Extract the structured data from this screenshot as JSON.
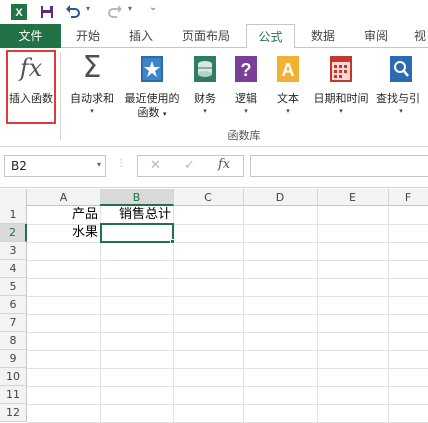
{
  "quick_access": {
    "save_icon": "save-icon",
    "undo_icon": "undo-icon",
    "redo_icon": "redo-icon",
    "customize_icon": "customize-qat-icon"
  },
  "tabs": [
    {
      "label": "文件"
    },
    {
      "label": "开始"
    },
    {
      "label": "插入"
    },
    {
      "label": "页面布局"
    },
    {
      "label": "公式"
    },
    {
      "label": "数据"
    },
    {
      "label": "审阅"
    },
    {
      "label": "视"
    }
  ],
  "ribbon": {
    "insert_function": {
      "label": "插入函数",
      "icon": "fx"
    },
    "autosum": {
      "label": "自动求和",
      "icon": "Σ"
    },
    "recently_used": {
      "label": "最近使用的",
      "label2": "函数"
    },
    "financial": {
      "label": "财务"
    },
    "logical": {
      "label": "逻辑"
    },
    "text": {
      "label": "文本",
      "icon_letter": "A"
    },
    "datetime": {
      "label": "日期和时间"
    },
    "lookup": {
      "label": "查找与引"
    },
    "group_label": "函数库",
    "dropdown_glyph": "▾"
  },
  "formula_bar": {
    "name_box": "B2",
    "fx_label": "fx",
    "formula": ""
  },
  "grid": {
    "columns": [
      "A",
      "B",
      "C",
      "D",
      "E",
      "F"
    ],
    "rows": [
      "1",
      "2",
      "3",
      "4",
      "5",
      "6",
      "7",
      "8",
      "9",
      "10",
      "11",
      "12"
    ],
    "cells": {
      "A1": "产品",
      "B1": "销售总计",
      "A2": "水果"
    },
    "selected_cell": "B2"
  },
  "colors": {
    "accent": "#217346",
    "highlight": "#e03a3a"
  }
}
